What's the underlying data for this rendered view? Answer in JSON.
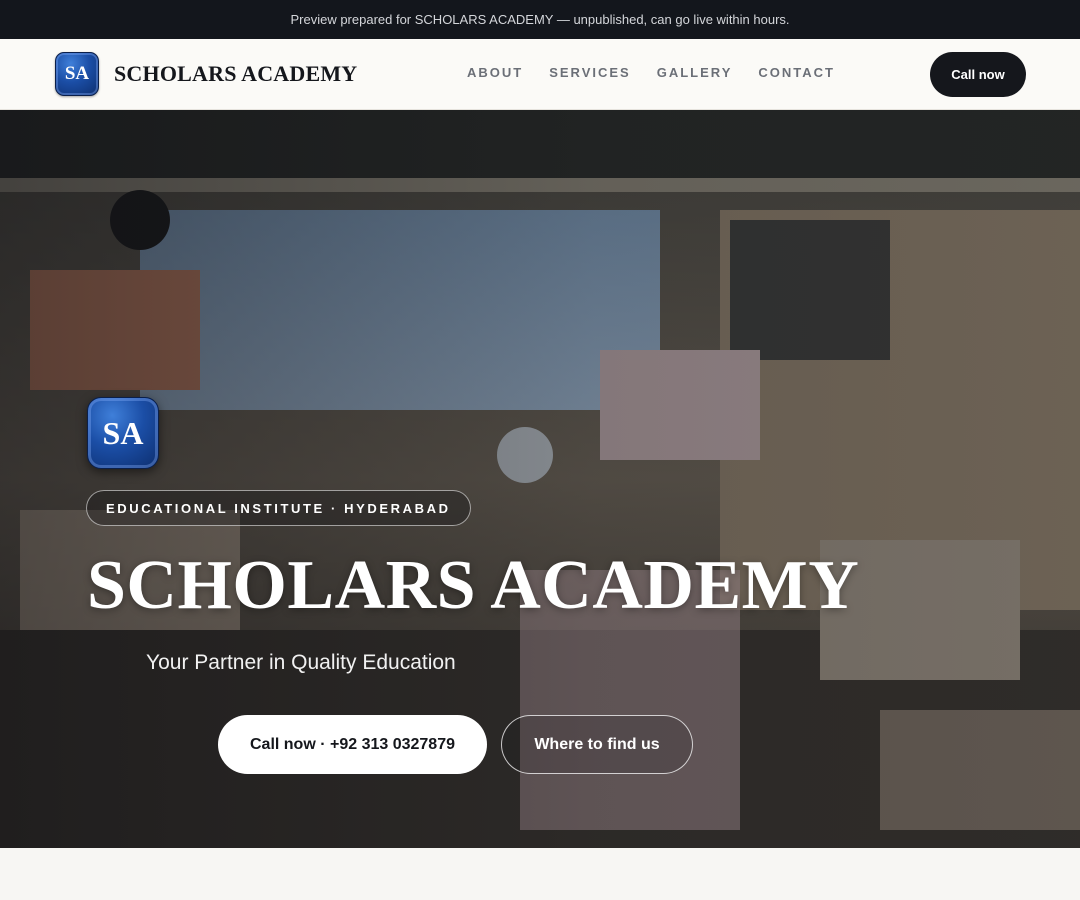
{
  "topbar": {
    "text": "Preview prepared for SCHOLARS ACADEMY — unpublished, can go live within hours."
  },
  "header": {
    "logo_initials": "SA",
    "brand": "SCHOLARS ACADEMY",
    "nav": [
      "ABOUT",
      "SERVICES",
      "GALLERY",
      "CONTACT"
    ],
    "cta": "Call now"
  },
  "hero": {
    "badge_initials": "SA",
    "eyebrow": "EDUCATIONAL INSTITUTE · HYDERABAD",
    "title": "SCHOLARS ACADEMY",
    "subtitle": "Your Partner in Quality Education",
    "primary_button": "Call now · +92 313 0327879",
    "secondary_button": "Where to find us",
    "background_image": "interior photo of a crowded shop / restaurant kitchen"
  },
  "colors": {
    "topbar_bg": "#13161c",
    "header_bg": "#fbfaf7",
    "cta_bg": "#15171c",
    "badge_blue": "#1b4ea6",
    "page_bg": "#f7f6f3"
  }
}
